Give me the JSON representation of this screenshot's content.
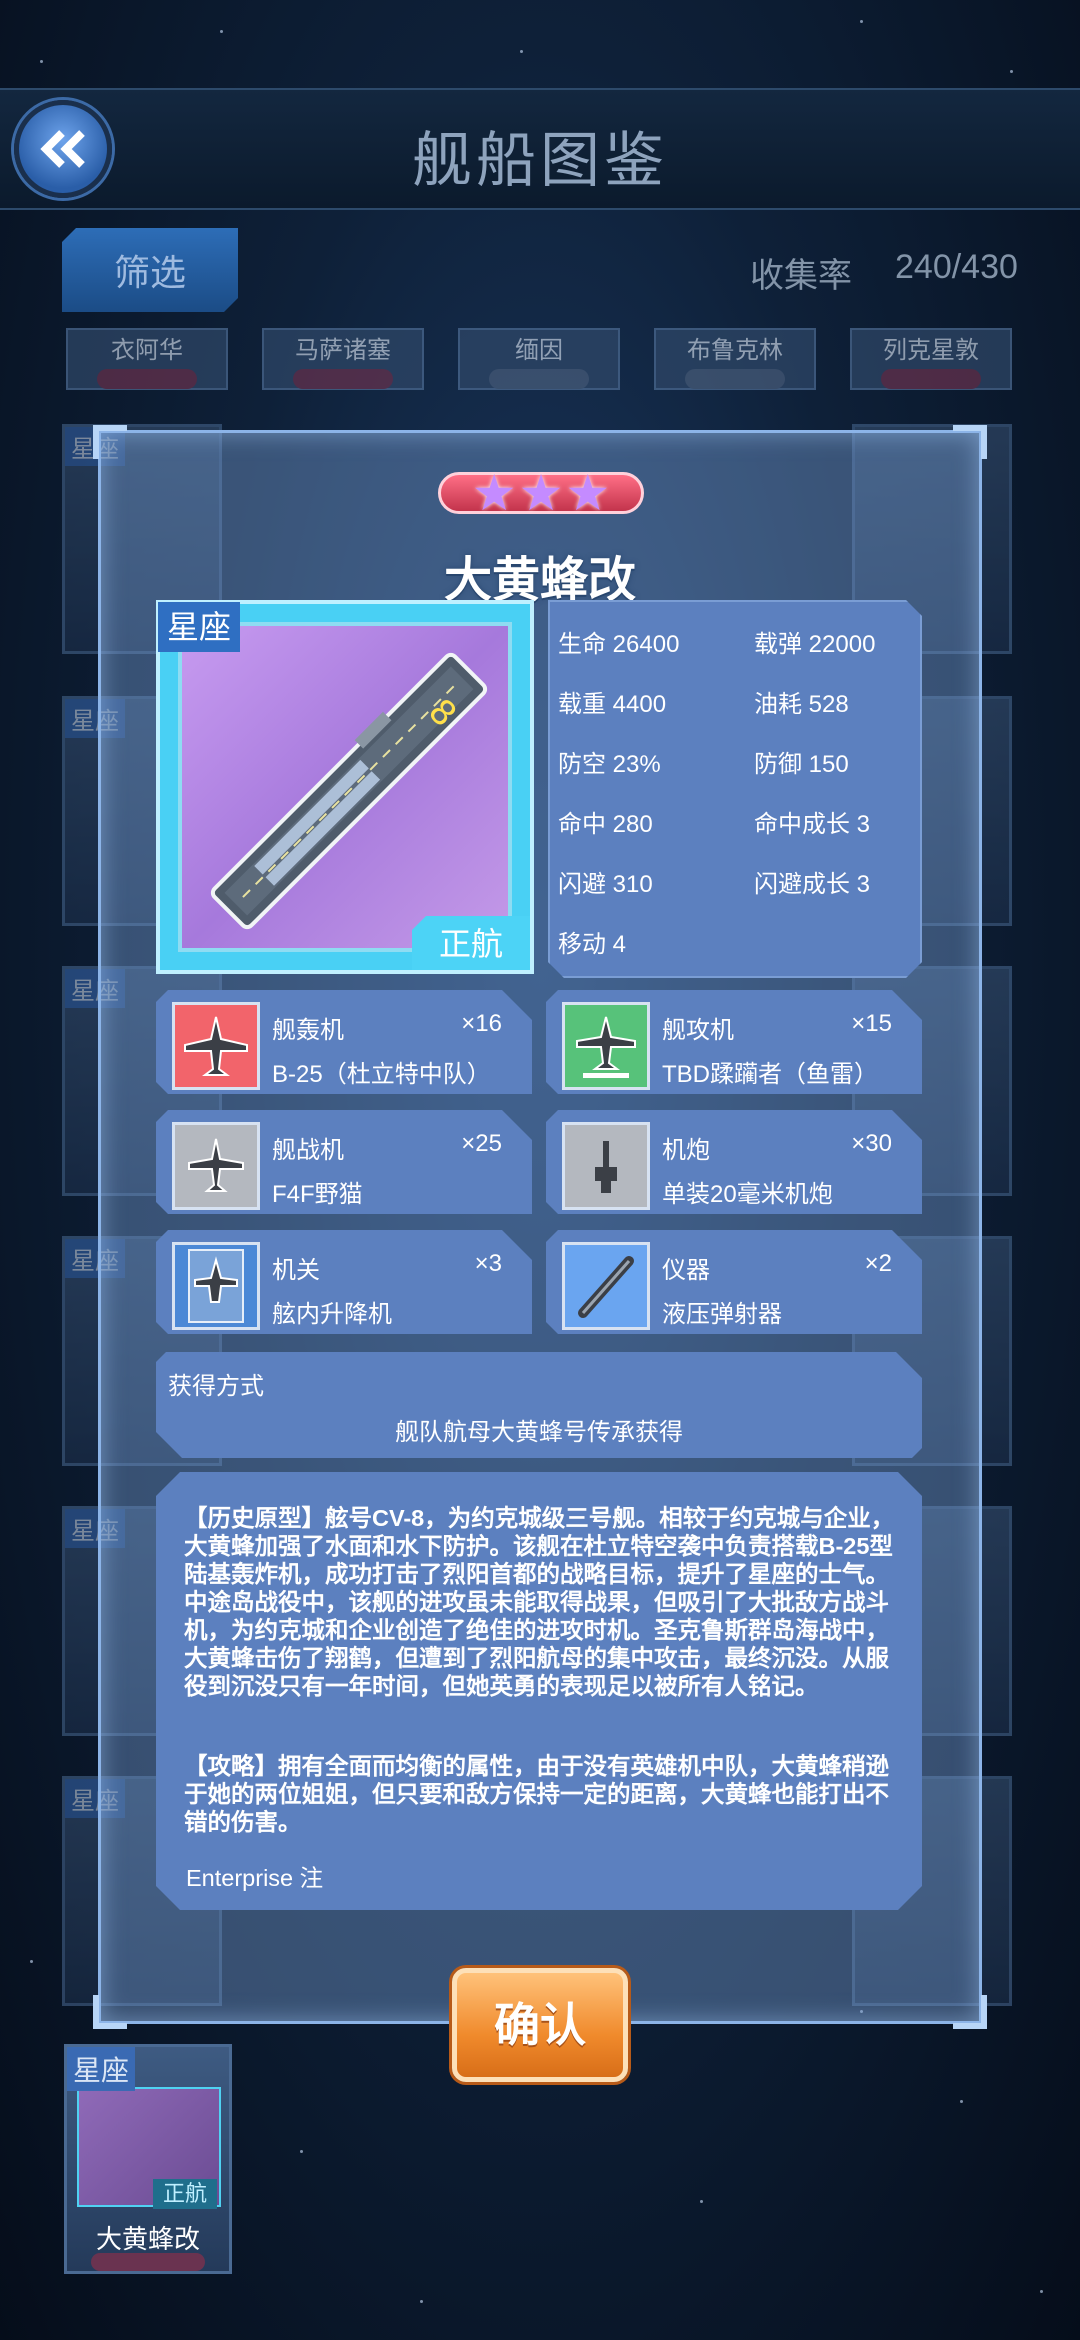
{
  "header": {
    "title": "舰船图鉴"
  },
  "toolbar": {
    "filter_label": "筛选",
    "collect_label": "收集率",
    "collect_value": "240/430"
  },
  "background_grid": {
    "top_row": [
      "衣阿华",
      "马萨诸塞",
      "缅因",
      "布鲁克林",
      "列克星敦"
    ],
    "badge": "星座",
    "bottom_card": {
      "badge": "星座",
      "tag": "正航",
      "name": "大黄蜂改"
    }
  },
  "ship": {
    "name": "大黄蜂改",
    "rarity_stars": 3,
    "class_tag": "星座",
    "type_tag": "正航",
    "stats": [
      {
        "label": "生命",
        "value": "26400"
      },
      {
        "label": "载弹",
        "value": "22000"
      },
      {
        "label": "载重",
        "value": "4400"
      },
      {
        "label": "油耗",
        "value": "528"
      },
      {
        "label": "防空",
        "value": "23%"
      },
      {
        "label": "防御",
        "value": "150"
      },
      {
        "label": "命中",
        "value": "280"
      },
      {
        "label": "命中成长",
        "value": "3"
      },
      {
        "label": "闪避",
        "value": "310"
      },
      {
        "label": "闪避成长",
        "value": "3"
      },
      {
        "label": "移动",
        "value": "4"
      }
    ],
    "equipment": [
      {
        "label": "舰轰机",
        "count": "×16",
        "value": "B-25（杜立特中队）",
        "icon": "bomber-plane-icon",
        "color": "#f2646b"
      },
      {
        "label": "舰攻机",
        "count": "×15",
        "value": "TBD蹂躏者（鱼雷）",
        "icon": "torpedo-plane-icon",
        "color": "#57c27a"
      },
      {
        "label": "舰战机",
        "count": "×25",
        "value": "F4F野猫",
        "icon": "fighter-plane-icon",
        "color": "#b4b8bf"
      },
      {
        "label": "机炮",
        "count": "×30",
        "value": "单装20毫米机炮",
        "icon": "machine-gun-icon",
        "color": "#b4b8bf"
      },
      {
        "label": "机关",
        "count": "×3",
        "value": "舷内升降机",
        "icon": "elevator-icon",
        "color": "#4b88d6"
      },
      {
        "label": "仪器",
        "count": "×2",
        "value": "液压弹射器",
        "icon": "catapult-icon",
        "color": "#6aa5f0"
      }
    ],
    "acquire": {
      "label": "获得方式",
      "value": "舰队航母大黄蜂号传承获得"
    },
    "description": {
      "history": "【历史原型】舷号CV-8，为约克城级三号舰。相较于约克城与企业，大黄蜂加强了水面和水下防护。该舰在杜立特空袭中负责搭载B-25型陆基轰炸机，成功打击了烈阳首都的战略目标，提升了星座的士气。中途岛战役中，该舰的进攻虽未能取得战果，但吸引了大批敌方战斗机，为约克城和企业创造了绝佳的进攻时机。圣克鲁斯群岛海战中，大黄蜂击伤了翔鹤，但遭到了烈阳航母的集中攻击，最终沉没。从服役到沉没只有一年时间，但她英勇的表现足以被所有人铭记。",
      "strategy": "【攻略】拥有全面而均衡的属性，由于没有英雄机中队，大黄蜂稍逊于她的两位姐姐，但只要和敌方保持一定的距离，大黄蜂也能打出不错的伤害。",
      "author": "Enterprise 注"
    }
  },
  "confirm_label": "确认",
  "colors": {
    "panel": "#5c80bf",
    "accent_cyan": "#49d0f4",
    "confirm_orange": "#f08a2c",
    "rarity_pink": "#e04a63",
    "star_purple": "#c48bff"
  }
}
